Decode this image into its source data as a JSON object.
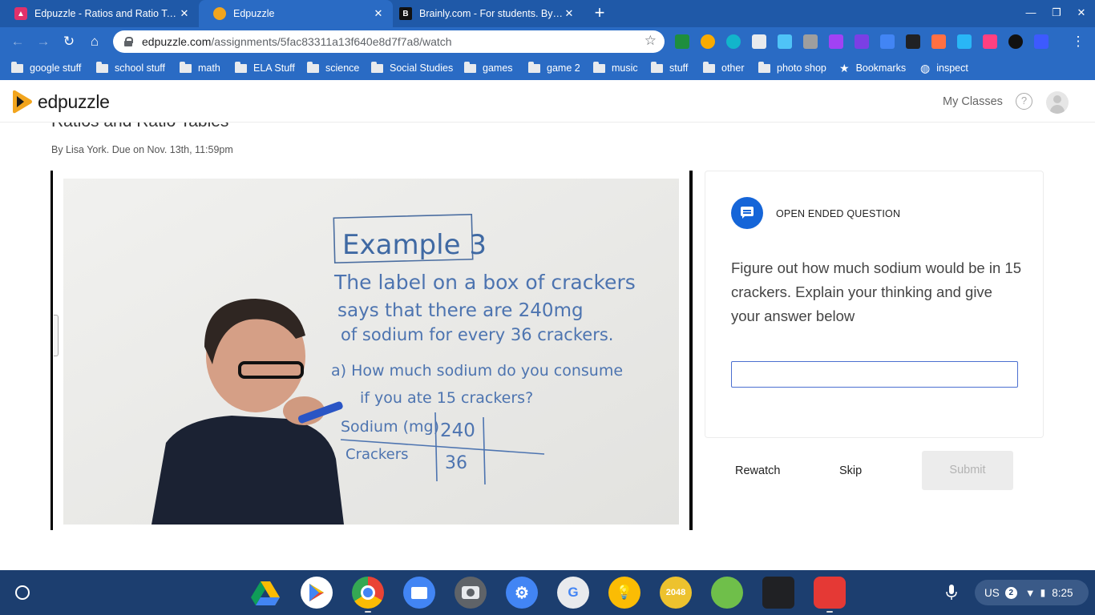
{
  "browser": {
    "tabs": [
      {
        "title": "Edpuzzle - Ratios and Ratio Tables",
        "favicon": "edpuzzle-classroom-icon",
        "active": false
      },
      {
        "title": "Edpuzzle",
        "favicon": "edpuzzle-icon",
        "active": true
      },
      {
        "title": "Brainly.com - For students. By students",
        "favicon": "brainly-icon",
        "active": false
      }
    ],
    "new_tab": "+",
    "address": {
      "host": "edpuzzle.com",
      "path": "/assignments/5fac83311a13f640e8d7f7a8/watch"
    },
    "bookmarks": [
      {
        "label": "google stuff",
        "icon": "folder-icon"
      },
      {
        "label": "school stuff",
        "icon": "folder-icon"
      },
      {
        "label": "math",
        "icon": "folder-icon"
      },
      {
        "label": "ELA Stuff",
        "icon": "folder-icon"
      },
      {
        "label": "science",
        "icon": "folder-icon"
      },
      {
        "label": "Social Studies",
        "icon": "folder-icon"
      },
      {
        "label": "games",
        "icon": "folder-icon"
      },
      {
        "label": "game 2",
        "icon": "folder-icon"
      },
      {
        "label": "music",
        "icon": "folder-icon"
      },
      {
        "label": "stuff",
        "icon": "folder-icon"
      },
      {
        "label": "other",
        "icon": "folder-icon"
      },
      {
        "label": "photo shop",
        "icon": "folder-icon"
      },
      {
        "label": "Bookmarks",
        "icon": "star-icon"
      },
      {
        "label": "inspect",
        "icon": "globe-icon"
      }
    ]
  },
  "header": {
    "logo_text": "edpuzzle",
    "my_classes": "My Classes",
    "help": "?"
  },
  "assignment": {
    "title": "Ratios and Ratio Tables",
    "meta": "By Lisa York. Due on Nov. 13th, 11:59pm"
  },
  "whiteboard": {
    "heading": "Example 3",
    "lines": [
      "The label on a box of crackers",
      "says that there are 240mg",
      "of sodium for every 36 crackers."
    ],
    "question_lines": [
      "a) How much sodium do you consume",
      "if you ate 15 crackers?"
    ],
    "table": {
      "row1_label": "Sodium (mg)",
      "row1_value": "240",
      "row2_label": "Crackers",
      "row2_value": "36"
    }
  },
  "question": {
    "type_label": "OPEN ENDED QUESTION",
    "text": "Figure out how much sodium would be in 15 crackers. Explain your thinking and give your answer below",
    "answer_value": ""
  },
  "actions": {
    "rewatch": "Rewatch",
    "skip": "Skip",
    "submit": "Submit"
  },
  "shelf": {
    "apps": [
      "google-drive-icon",
      "play-store-icon",
      "chrome-icon",
      "files-icon",
      "camera-icon",
      "settings-icon",
      "google-translate-icon",
      "keep-icon",
      "2048-game-icon",
      "word-game-icon",
      "calculator-icon",
      "video-editor-icon"
    ],
    "app_2048_label": "2048",
    "ime": "US",
    "notifications": "2",
    "time": "8:25"
  },
  "colors": {
    "chrome": "#1f59a8",
    "accent": "#1565d8",
    "shelf": "#1c3e6f"
  }
}
